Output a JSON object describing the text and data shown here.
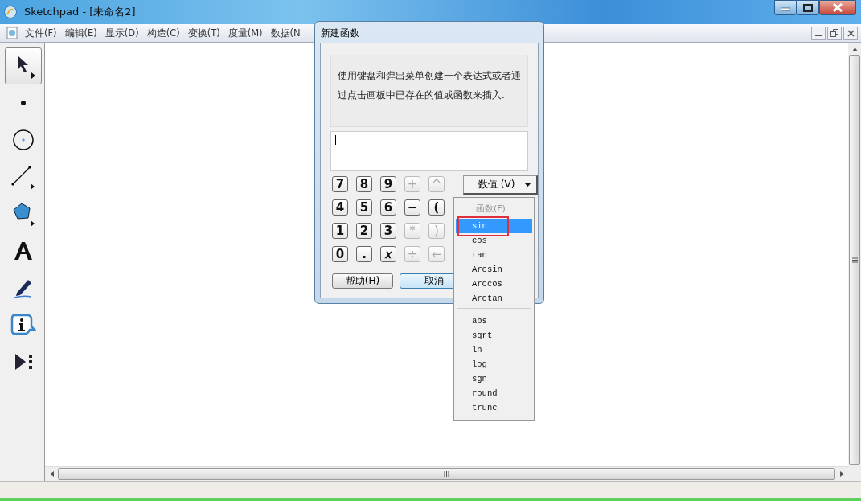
{
  "window": {
    "title": "Sketchpad  - [未命名2]"
  },
  "menu_bar": [
    "文件(F)",
    "编辑(E)",
    "显示(D)",
    "构造(C)",
    "变换(T)",
    "度量(M)",
    "数据(N"
  ],
  "toolbar": [
    {
      "kind": "arrow",
      "selected": true
    },
    {
      "kind": "point",
      "selected": false
    },
    {
      "kind": "compass",
      "selected": false
    },
    {
      "kind": "line",
      "selected": false
    },
    {
      "kind": "polygon",
      "selected": false
    },
    {
      "kind": "text",
      "selected": false
    },
    {
      "kind": "marker",
      "selected": false
    },
    {
      "kind": "info",
      "selected": false
    },
    {
      "kind": "custom",
      "selected": false
    }
  ],
  "dialog": {
    "title": "新建函数",
    "description": "使用键盘和弹出菜单创建一个表达式或者通过点击画板中已存在的值或函数来插入.",
    "keypad": [
      [
        {
          "label": "7",
          "disabled": false
        },
        {
          "label": "8",
          "disabled": false
        },
        {
          "label": "9",
          "disabled": false
        },
        {
          "label": "+",
          "disabled": true
        },
        {
          "label": "^",
          "disabled": true
        }
      ],
      [
        {
          "label": "4",
          "disabled": false
        },
        {
          "label": "5",
          "disabled": false
        },
        {
          "label": "6",
          "disabled": false
        },
        {
          "label": "−",
          "disabled": false
        },
        {
          "label": "(",
          "disabled": false
        }
      ],
      [
        {
          "label": "1",
          "disabled": false
        },
        {
          "label": "2",
          "disabled": false
        },
        {
          "label": "3",
          "disabled": false
        },
        {
          "label": "*",
          "disabled": true
        },
        {
          "label": ")",
          "disabled": true
        }
      ],
      [
        {
          "label": "0",
          "disabled": false
        },
        {
          "label": ".",
          "disabled": false
        },
        {
          "label": "𝑥",
          "disabled": false
        },
        {
          "label": "÷",
          "disabled": true
        },
        {
          "label": "←",
          "disabled": true
        }
      ]
    ],
    "values_dropdown": "数值 (V)",
    "buttons": [
      "帮助(H)",
      "取消"
    ]
  },
  "function_menu": {
    "header": "函数(F)",
    "groups": [
      [
        {
          "label": "sin",
          "selected": true,
          "highlighted": true
        },
        {
          "label": "cos",
          "selected": false,
          "highlighted": false
        },
        {
          "label": "tan",
          "selected": false,
          "highlighted": false
        },
        {
          "label": "Arcsin",
          "selected": false,
          "highlighted": false
        },
        {
          "label": "Arccos",
          "selected": false,
          "highlighted": false
        },
        {
          "label": "Arctan",
          "selected": false,
          "highlighted": false
        }
      ],
      [
        {
          "label": "abs",
          "selected": false,
          "highlighted": false
        },
        {
          "label": "sqrt",
          "selected": false,
          "highlighted": false
        },
        {
          "label": "ln",
          "selected": false,
          "highlighted": false
        },
        {
          "label": "log",
          "selected": false,
          "highlighted": false
        },
        {
          "label": "sgn",
          "selected": false,
          "highlighted": false
        },
        {
          "label": "round",
          "selected": false,
          "highlighted": false
        },
        {
          "label": "trunc",
          "selected": false,
          "highlighted": false
        }
      ]
    ]
  }
}
